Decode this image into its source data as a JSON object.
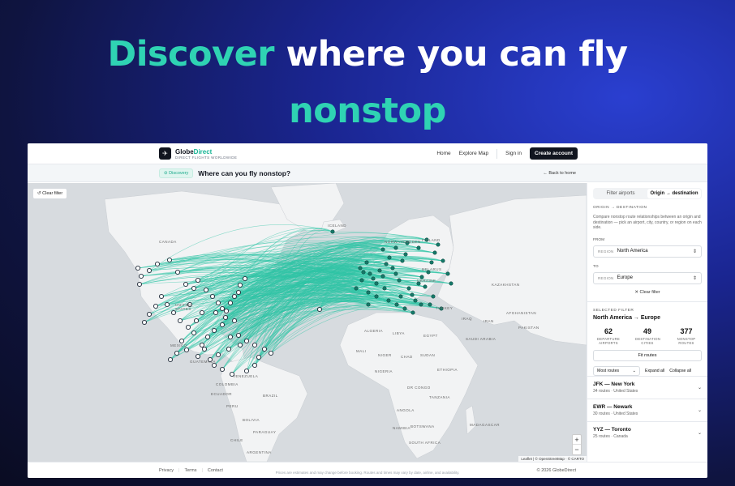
{
  "hero": {
    "line1_accent": "Discover",
    "line1_rest": " where you can fly",
    "line2": "nonstop"
  },
  "nav": {
    "brand_part1": "Globe",
    "brand_part2": "Direct",
    "brand_tagline": "DIRECT FLIGHTS WORLDWIDE",
    "home": "Home",
    "explore": "Explore Map",
    "signin": "Sign in",
    "create": "Create account"
  },
  "subheader": {
    "badge": "Discovery",
    "title": "Where can you fly nonstop?",
    "back": "Back to home"
  },
  "map": {
    "clear_filter": "Clear filter",
    "zoom_in": "+",
    "zoom_out": "−",
    "attribution": "Leaflet | © OpenStreetMap · © CARTO",
    "labels": {
      "iceland": "ICELAND",
      "canada": "CANADA",
      "united_states": "UNITED STATES",
      "mexico": "MEXICO",
      "guatemala": "GUATEMALA",
      "venezuela": "VENEZUELA",
      "colombia": "COLOMBIA",
      "ecuador": "ECUADOR",
      "peru": "PERU",
      "brazil": "BRAZIL",
      "bolivia": "BOLIVIA",
      "paraguay": "PARAGUAY",
      "chile": "CHILE",
      "argentina": "ARGENTINA",
      "norway": "NORWAY",
      "sweden": "SWEDEN",
      "finland": "FINLAND",
      "belarus": "BELARUS",
      "ukraine": "UKRAINE",
      "kazakhstan": "KAZAKHSTAN",
      "turkey": "TURKEY",
      "iraq": "IRAQ",
      "iran": "IRAN",
      "afghanistan": "AFGHANISTAN",
      "pakistan": "PAKISTAN",
      "mali": "MALI",
      "niger": "NIGER",
      "chad": "CHAD",
      "sudan": "SUDAN",
      "nigeria": "NIGERIA",
      "ethiopia": "ETHIOPIA",
      "libya": "LIBYA",
      "egypt": "EGYPT",
      "algeria": "ALGERIA",
      "saudi_arabia": "SAUDI ARABIA",
      "dr_congo": "DR CONGO",
      "tanzania": "TANZANIA",
      "angola": "ANGOLA",
      "namibia": "NAMIBIA",
      "botswana": "BOTSWANA",
      "madagascar": "MADAGASCAR",
      "south_africa": "SOUTH AFRICA"
    }
  },
  "panel": {
    "tab1": "Filter airports",
    "tab2": "Origin → destination",
    "section": "ORIGIN → DESTINATION",
    "description": "Compare nonstop route relationships between an origin and destination — pick an airport, city, country, or region on each side.",
    "from_label": "FROM",
    "to_label": "TO",
    "region_prefix": "REGION",
    "from_value": "North America",
    "to_value": "Europe",
    "clear_filter": "Clear filter",
    "selected_label": "SELECTED FILTER",
    "selected_name": "North America → Europe",
    "stats": [
      {
        "value": "62",
        "label": "DEPARTURE AIRPORTS"
      },
      {
        "value": "49",
        "label": "DESTINATION CITIES"
      },
      {
        "value": "377",
        "label": "NONSTOP ROUTES"
      }
    ],
    "fit_routes": "Fit routes",
    "sort_value": "Most routes",
    "expand_all": "Expand all",
    "collapse_all": "Collapse all",
    "routes": [
      {
        "code": "JFK — New York",
        "meta": "34 routes · United States"
      },
      {
        "code": "EWR — Newark",
        "meta": "30 routes · United States"
      },
      {
        "code": "YYZ — Toronto",
        "meta": "25 routes · Canada"
      }
    ]
  },
  "footer": {
    "privacy": "Privacy",
    "terms": "Terms",
    "contact": "Contact",
    "copyright": "© 2026 GlobeDirect",
    "disclaimer": "Prices are estimates and may change before booking. Routes and times may vary by date, airline, and availability."
  },
  "colors": {
    "accent": "#2fd3b3",
    "route": "#2fc4a6",
    "dark": "#11151f"
  }
}
